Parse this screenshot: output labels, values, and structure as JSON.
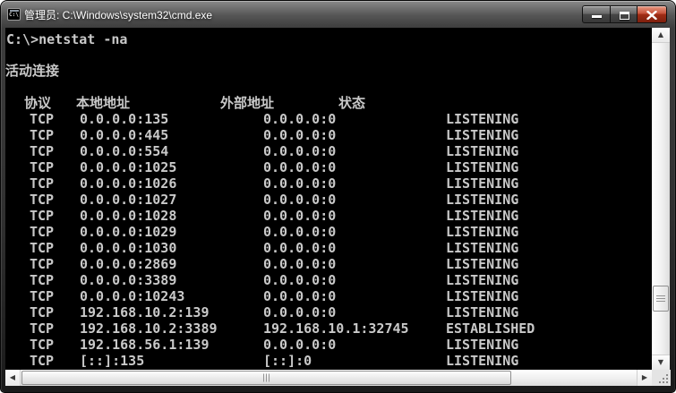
{
  "window": {
    "title": "管理员: C:\\Windows\\system32\\cmd.exe"
  },
  "console": {
    "prompt_line": "C:\\>netstat -na",
    "section_label": "活动连接",
    "table": {
      "headers": {
        "proto": "协议",
        "local": "本地地址",
        "foreign": "外部地址",
        "state": "状态"
      },
      "rows": [
        {
          "proto": "TCP",
          "local": "0.0.0.0:135",
          "foreign": "0.0.0.0:0",
          "state": "LISTENING"
        },
        {
          "proto": "TCP",
          "local": "0.0.0.0:445",
          "foreign": "0.0.0.0:0",
          "state": "LISTENING"
        },
        {
          "proto": "TCP",
          "local": "0.0.0.0:554",
          "foreign": "0.0.0.0:0",
          "state": "LISTENING"
        },
        {
          "proto": "TCP",
          "local": "0.0.0.0:1025",
          "foreign": "0.0.0.0:0",
          "state": "LISTENING"
        },
        {
          "proto": "TCP",
          "local": "0.0.0.0:1026",
          "foreign": "0.0.0.0:0",
          "state": "LISTENING"
        },
        {
          "proto": "TCP",
          "local": "0.0.0.0:1027",
          "foreign": "0.0.0.0:0",
          "state": "LISTENING"
        },
        {
          "proto": "TCP",
          "local": "0.0.0.0:1028",
          "foreign": "0.0.0.0:0",
          "state": "LISTENING"
        },
        {
          "proto": "TCP",
          "local": "0.0.0.0:1029",
          "foreign": "0.0.0.0:0",
          "state": "LISTENING"
        },
        {
          "proto": "TCP",
          "local": "0.0.0.0:1030",
          "foreign": "0.0.0.0:0",
          "state": "LISTENING"
        },
        {
          "proto": "TCP",
          "local": "0.0.0.0:2869",
          "foreign": "0.0.0.0:0",
          "state": "LISTENING"
        },
        {
          "proto": "TCP",
          "local": "0.0.0.0:3389",
          "foreign": "0.0.0.0:0",
          "state": "LISTENING"
        },
        {
          "proto": "TCP",
          "local": "0.0.0.0:10243",
          "foreign": "0.0.0.0:0",
          "state": "LISTENING"
        },
        {
          "proto": "TCP",
          "local": "192.168.10.2:139",
          "foreign": "0.0.0.0:0",
          "state": "LISTENING"
        },
        {
          "proto": "TCP",
          "local": "192.168.10.2:3389",
          "foreign": "192.168.10.1:32745",
          "state": "ESTABLISHED"
        },
        {
          "proto": "TCP",
          "local": "192.168.56.1:139",
          "foreign": "0.0.0.0:0",
          "state": "LISTENING"
        },
        {
          "proto": "TCP",
          "local": "[::]:135",
          "foreign": "[::]:0",
          "state": "LISTENING"
        }
      ]
    }
  },
  "colors": {
    "console_bg": "#000000",
    "console_fg": "#c9c9c9",
    "close_button_red": "#a02d16",
    "titlebar_gray": "#3d3d3d",
    "scrollbar_track": "#f1f1f1"
  }
}
